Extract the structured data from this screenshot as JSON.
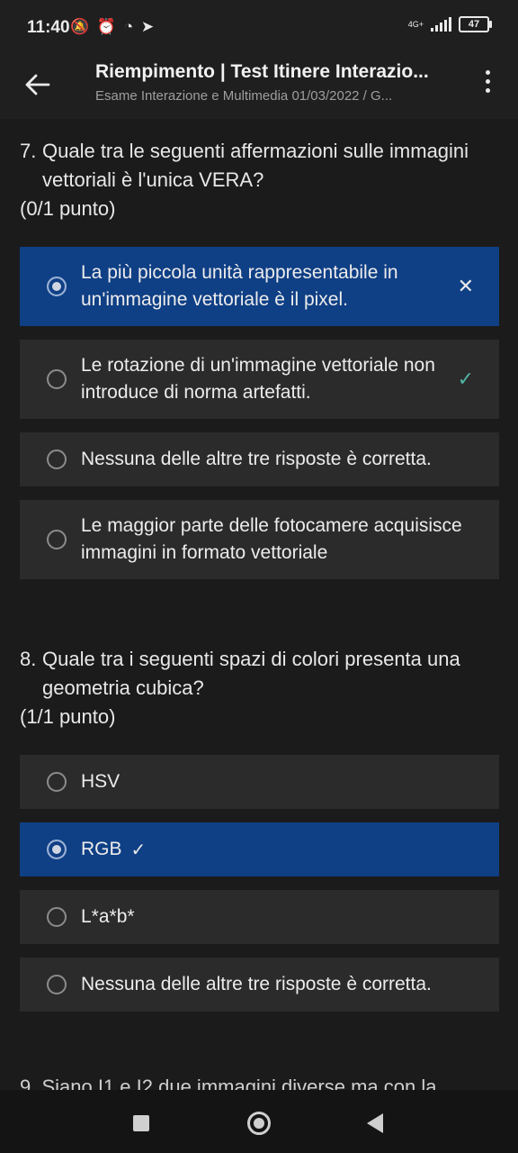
{
  "status": {
    "time": "11:40",
    "icons": [
      "bell-off-icon",
      "alarm-icon",
      "whatsapp-icon",
      "telegram-icon"
    ],
    "network": "4G+",
    "battery": "47"
  },
  "header": {
    "title": "Riempimento | Test Itinere Interazio...",
    "subtitle": "Esame Interazione e Multimedia 01/03/2022 / G..."
  },
  "questions": [
    {
      "number": "7.",
      "text": "Quale tra le seguenti affermazioni sulle immagini vettoriali è l'unica VERA?",
      "score": "(0/1 punto)",
      "options": [
        {
          "label": "La più piccola unità rappresentabile in un'immagine vettoriale è il pixel.",
          "selected": true,
          "mark": "✕"
        },
        {
          "label": "Le rotazione di un'immagine vettoriale non introduce di norma artefatti.",
          "selected": false,
          "mark": "✓"
        },
        {
          "label": "Nessuna delle altre tre risposte è corretta.",
          "selected": false,
          "mark": ""
        },
        {
          "label": "Le maggior parte delle fotocamere acquisisce immagini in formato vettoriale",
          "selected": false,
          "mark": ""
        }
      ]
    },
    {
      "number": "8.",
      "text": "Quale tra i seguenti spazi di colori presenta una geometria cubica?",
      "score": "(1/1 punto)",
      "options": [
        {
          "label": "HSV",
          "selected": false,
          "mark": ""
        },
        {
          "label": "RGB",
          "selected": true,
          "mark": "✓"
        },
        {
          "label": "L*a*b*",
          "selected": false,
          "mark": ""
        },
        {
          "label": "Nessuna delle altre tre risposte è corretta.",
          "selected": false,
          "mark": ""
        }
      ]
    }
  ],
  "next_question_peek": "9. Siano I1 e I2 due immagini diverse ma con la",
  "colors": {
    "background": "#1b1b1b",
    "option_bg": "#2b2b2b",
    "selected_bg": "#0f3f85",
    "correct_mark": "#4fb3a3"
  }
}
